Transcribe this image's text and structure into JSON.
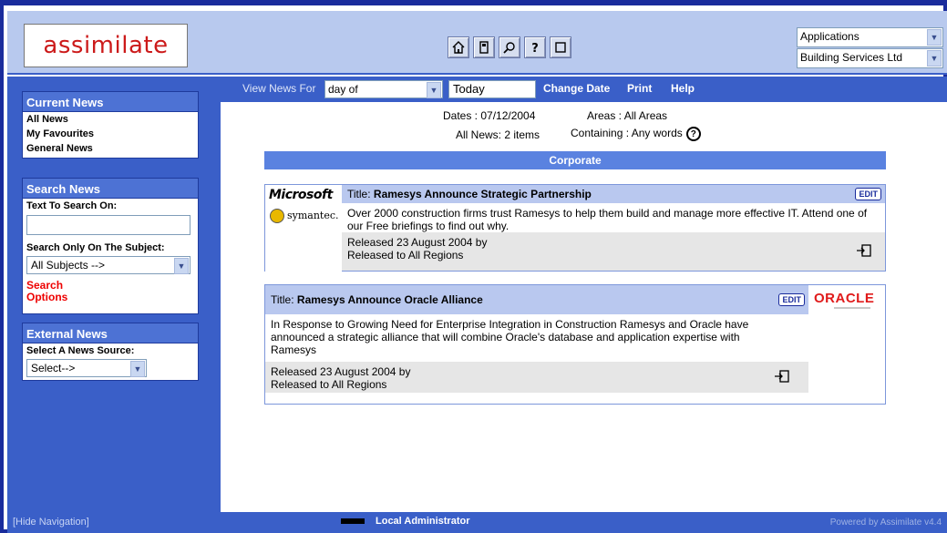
{
  "header": {
    "logo": "assimilate",
    "applications_select": "Applications",
    "company_select": "Building Services Ltd"
  },
  "sidebar": {
    "current_news": {
      "title": "Current News",
      "items": [
        "All News",
        "My Favourites",
        "General News"
      ]
    },
    "search_news": {
      "title": "Search News",
      "text_label": "Text To Search On:",
      "text_value": "",
      "subject_label": "Search Only On The Subject:",
      "subject_value": "All Subjects -->",
      "options_link": "Search Options"
    },
    "external_news": {
      "title": "External News",
      "source_label": "Select A News Source:",
      "source_value": "Select-->"
    }
  },
  "main": {
    "topbar": {
      "view_news_for_label": "View News For",
      "period_value": "day of",
      "date_value": "Today",
      "change_date": "Change Date",
      "print": "Print",
      "help": "Help"
    },
    "meta": {
      "dates": "Dates : 07/12/2004",
      "areas": "Areas : All Areas",
      "count": "All News: 2 items",
      "containing": "Containing : Any words"
    },
    "section_title": "Corporate",
    "articles": [
      {
        "logo_primary": "Microsoft",
        "logo_secondary": "symantec.",
        "title_prefix": "Title:",
        "title": "Ramesys Announce Strategic Partnership",
        "edit": "EDIT",
        "body": "Over 2000 construction firms trust Ramesys to help them build and manage more effective IT. Attend one of our Free briefings to find out why.",
        "released": "Released 23 August 2004 by",
        "regions": "Released to All Regions"
      },
      {
        "logo_primary": "ORACLE",
        "title_prefix": "Title:",
        "title": "Ramesys Announce Oracle Alliance",
        "edit": "EDIT",
        "body": "In Response to Growing Need for Enterprise Integration in Construction Ramesys and Oracle have announced a strategic alliance that will combine Oracle's database and application expertise with Ramesys",
        "released": "Released 23 August 2004 by",
        "regions": "Released to All Regions"
      }
    ]
  },
  "bottombar": {
    "hide_navigation": "[Hide Navigation]",
    "user": "Local Administrator",
    "powered_by": "Powered by Assimilate v4.4"
  },
  "colors": {
    "frame": "#1a2c9c",
    "sidebar": "#3a5fc8",
    "header": "#b8c9ee",
    "logo_red": "#cc1a1a",
    "section_bar": "#5a82e0"
  }
}
